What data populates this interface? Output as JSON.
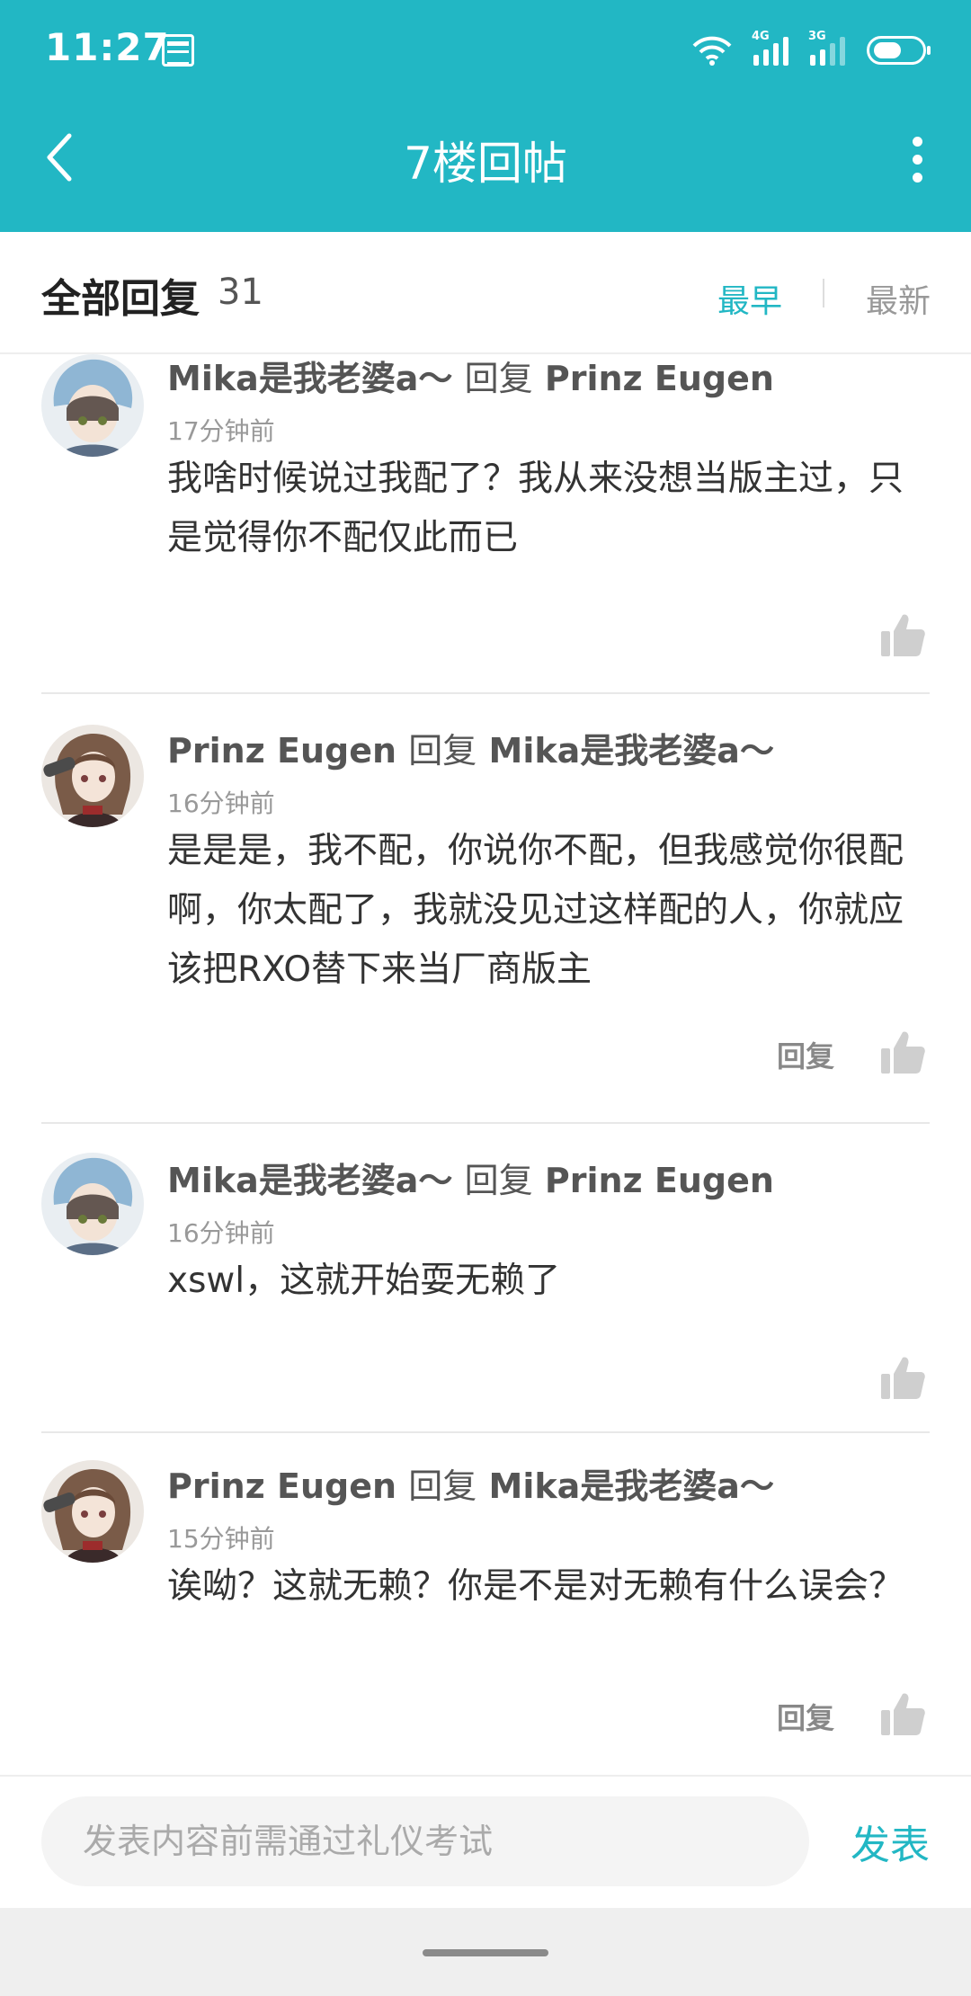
{
  "status_bar": {
    "time": "11:27",
    "news_icon": "news-icon",
    "sig1_tag": "4G",
    "sig2_tag": "3G",
    "battery_level": 0.6
  },
  "header": {
    "title": "7楼回帖",
    "back_icon": "chevron-left-icon",
    "more_icon": "more-vertical-icon"
  },
  "reply_header": {
    "title": "全部回复",
    "count": "31",
    "sort_earliest": "最早",
    "sort_latest": "最新"
  },
  "comments": [
    {
      "author": "Mika是我老婆a〜",
      "reply_word": "回复",
      "target": "Prinz Eugen",
      "time": "17分钟前",
      "content": "我啥时候说过我配了？我从来没想当版主过，只是觉得你不配仅此而已",
      "reply_label": "",
      "avatar": "avatar-blue-hood"
    },
    {
      "author": "Prinz Eugen",
      "reply_word": "回复",
      "target": "Mika是我老婆a〜",
      "time": "16分钟前",
      "content": "是是是，我不配，你说你不配，但我感觉你很配啊，你太配了，我就没见过这样配的人，你就应该把RXO替下来当厂商版主",
      "reply_label": "回复",
      "avatar": "avatar-brown-hair"
    },
    {
      "author": "Mika是我老婆a〜",
      "reply_word": "回复",
      "target": "Prinz Eugen",
      "time": "16分钟前",
      "content": "xswl，这就开始耍无赖了",
      "reply_label": "",
      "avatar": "avatar-blue-hood"
    },
    {
      "author": "Prinz Eugen",
      "reply_word": "回复",
      "target": "Mika是我老婆a〜",
      "time": "15分钟前",
      "content": "诶呦？这就无赖？你是不是对无赖有什么误会？",
      "reply_label": "回复",
      "avatar": "avatar-brown-hair"
    }
  ],
  "bottom_bar": {
    "input_placeholder": "发表内容前需通过礼仪考试",
    "send_label": "发表"
  },
  "colors": {
    "accent": "#22b7c4",
    "text_main": "#333333",
    "text_muted": "#999999"
  }
}
